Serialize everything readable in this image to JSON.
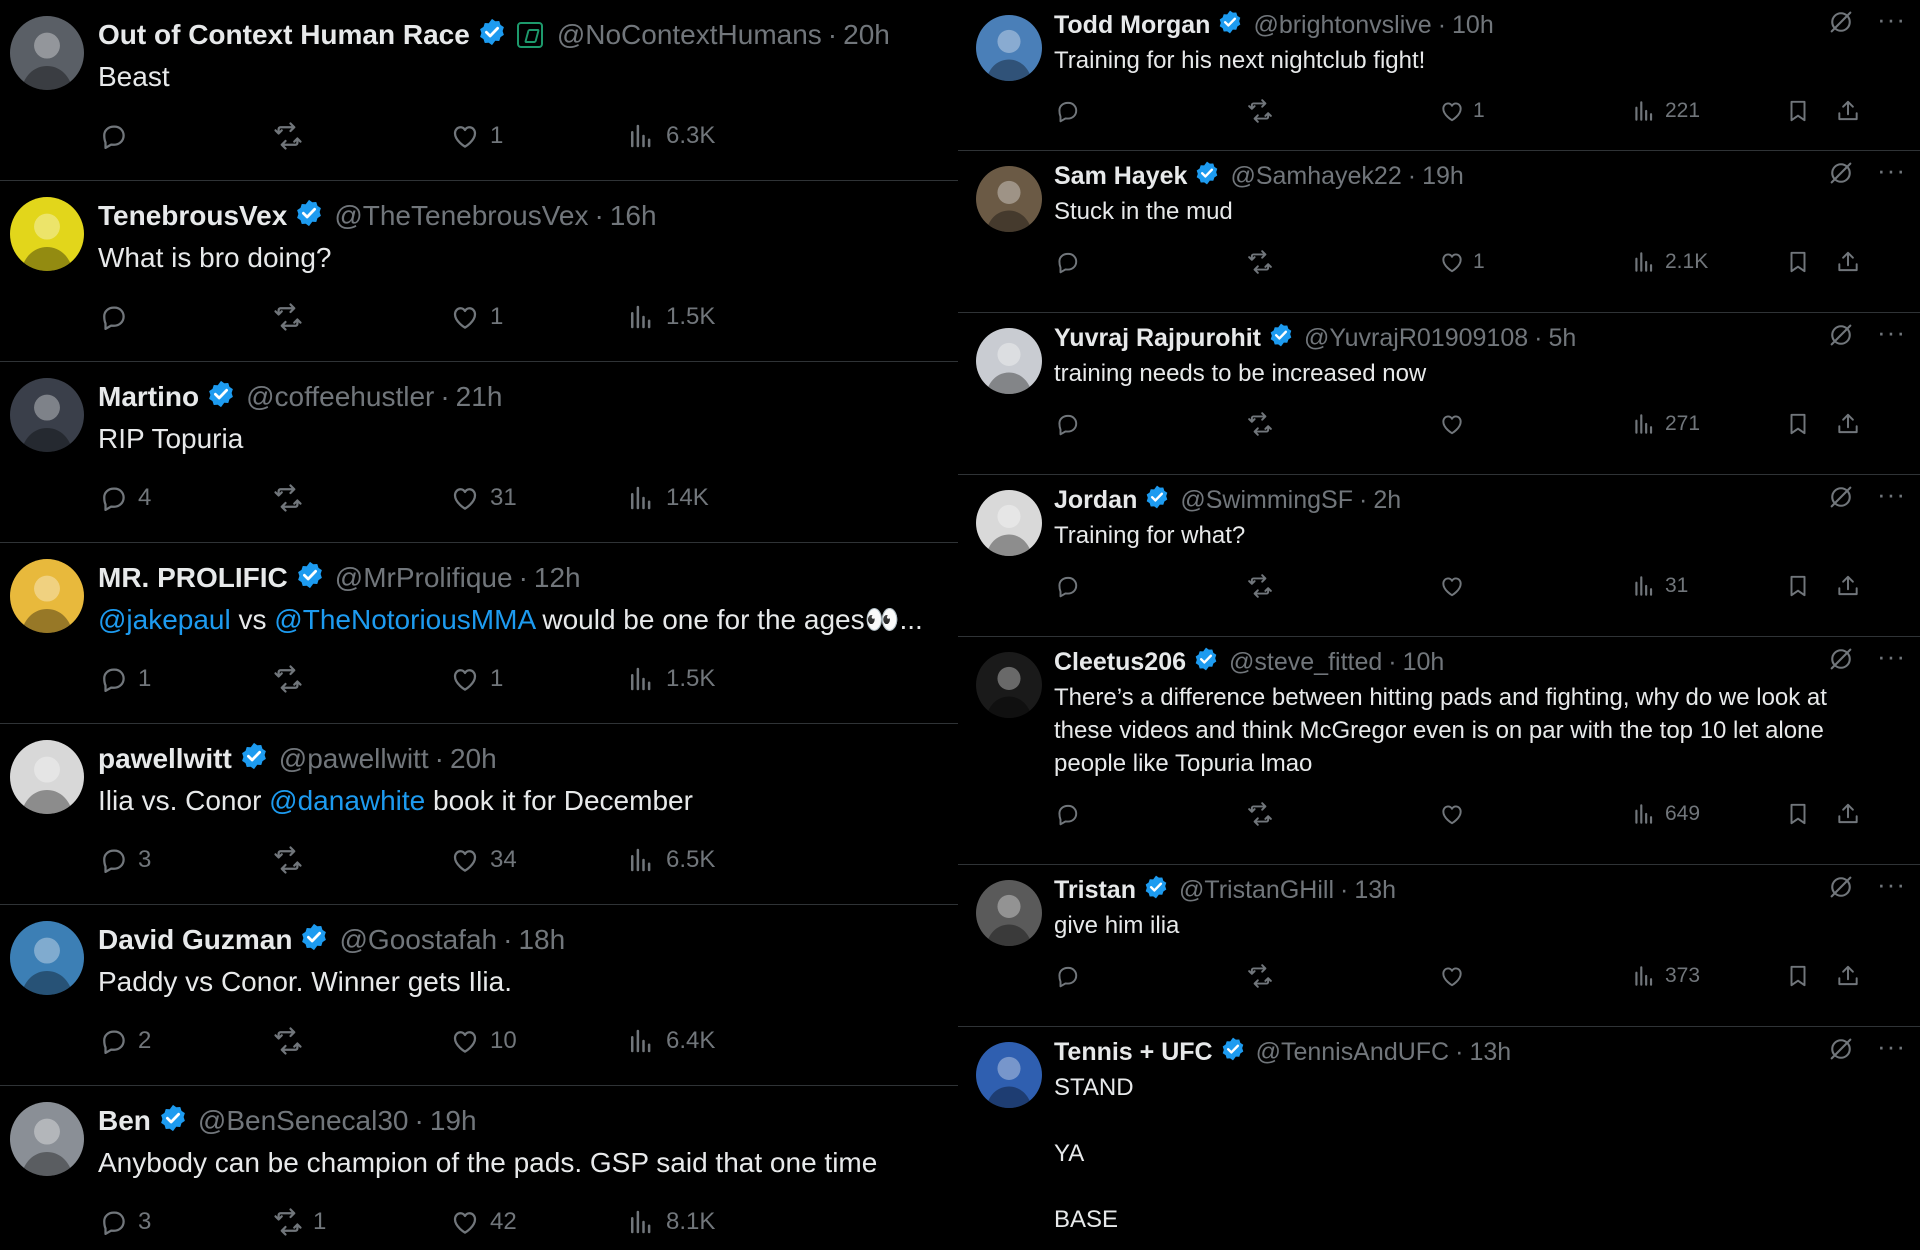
{
  "colors": {
    "background": "#000000",
    "text": "#e7e9ea",
    "muted": "#71767b",
    "accent": "#1d9bf0",
    "divider": "#2f3336"
  },
  "left_tweets": [
    {
      "name": "Out of Context Human Race",
      "handle": "@NoContextHumans",
      "time": "20h",
      "badge_icon": "affiliate-square-icon",
      "text": [
        {
          "t": "Beast"
        }
      ],
      "replies": "",
      "reposts": "",
      "likes": "1",
      "views": "6.3K",
      "avatar_color": "#5a5f66"
    },
    {
      "name": "TenebrousVex",
      "handle": "@TheTenebrousVex",
      "time": "16h",
      "text": [
        {
          "t": "What is bro doing?"
        }
      ],
      "replies": "",
      "reposts": "",
      "likes": "1",
      "views": "1.5K",
      "avatar_color": "#e2d61b"
    },
    {
      "name": "Martino",
      "handle": "@coffeehustler",
      "time": "21h",
      "text": [
        {
          "t": "RIP Topuria"
        }
      ],
      "replies": "4",
      "reposts": "",
      "likes": "31",
      "views": "14K",
      "avatar_color": "#3a3f4a"
    },
    {
      "name": "MR. PROLIFIC",
      "handle": "@MrProlifique",
      "time": "12h",
      "text": [
        {
          "t": "@jakepaul",
          "m": true
        },
        {
          "t": " vs "
        },
        {
          "t": "@TheNotoriousMMA",
          "m": true
        },
        {
          "t": " would be one for the ages👀..."
        }
      ],
      "replies": "1",
      "reposts": "",
      "likes": "1",
      "views": "1.5K",
      "avatar_color": "#e8b93c"
    },
    {
      "name": "pawellwitt",
      "handle": "@pawellwitt",
      "time": "20h",
      "text": [
        {
          "t": "Ilia vs. Conor "
        },
        {
          "t": "@danawhite",
          "m": true
        },
        {
          "t": " book it for December"
        }
      ],
      "replies": "3",
      "reposts": "",
      "likes": "34",
      "views": "6.5K",
      "avatar_color": "#d8d8d8"
    },
    {
      "name": "David Guzman",
      "handle": "@Goostafah",
      "time": "18h",
      "text": [
        {
          "t": "Paddy vs Conor. Winner gets Ilia."
        }
      ],
      "replies": "2",
      "reposts": "",
      "likes": "10",
      "views": "6.4K",
      "avatar_color": "#3c7fb5"
    },
    {
      "name": "Ben",
      "handle": "@BenSenecal30",
      "time": "19h",
      "text": [
        {
          "t": "Anybody can be champion of the pads. GSP said that one time"
        }
      ],
      "replies": "3",
      "reposts": "1",
      "likes": "42",
      "views": "8.1K",
      "avatar_color": "#8a8f96"
    }
  ],
  "right_tweets": [
    {
      "name": "Todd Morgan",
      "handle": "@brightonvslive",
      "time": "10h",
      "text": "Training for his next nightclub fight!",
      "replies": "",
      "reposts": "",
      "likes": "1",
      "views": "221",
      "avatar_color": "#4a7fb8"
    },
    {
      "name": "Sam Hayek",
      "handle": "@Samhayek22",
      "time": "19h",
      "text": "Stuck in the mud",
      "replies": "",
      "reposts": "",
      "likes": "1",
      "views": "2.1K",
      "avatar_color": "#6b5a45"
    },
    {
      "name": "Yuvraj Rajpurohit",
      "handle": "@YuvrajR01909108",
      "time": "5h",
      "text": "training needs to be increased now",
      "replies": "",
      "reposts": "",
      "likes": "",
      "views": "271",
      "avatar_color": "#c9ccd2"
    },
    {
      "name": "Jordan",
      "handle": "@SwimmingSF",
      "time": "2h",
      "text": "Training for what?",
      "replies": "",
      "reposts": "",
      "likes": "",
      "views": "31",
      "avatar_color": "#d9d9d9"
    },
    {
      "name": "Cleetus206",
      "handle": "@steve_fitted",
      "time": "10h",
      "text": "There’s a difference between hitting pads and fighting, why do we look at\nthese videos and think McGregor even is on par with the top 10 let alone\npeople like Topuria lmao",
      "replies": "",
      "reposts": "",
      "likes": "",
      "views": "649",
      "avatar_color": "#1a1a1a"
    },
    {
      "name": "Tristan",
      "handle": "@TristanGHill",
      "time": "13h",
      "text": "give him ilia",
      "replies": "",
      "reposts": "",
      "likes": "",
      "views": "373",
      "avatar_color": "#5a5a5a"
    },
    {
      "name": "Tennis + UFC",
      "handle": "@TennisAndUFC",
      "time": "13h",
      "text": "STAND\n\nYA\n\nBASE",
      "replies": "",
      "reposts": "",
      "likes": "",
      "views": "",
      "avatar_color": "#2f5fb0"
    }
  ]
}
